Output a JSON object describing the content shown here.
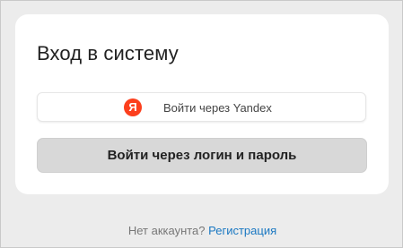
{
  "login": {
    "title": "Вход в систему",
    "yandex_button": {
      "logo_letter": "Я",
      "logo_color": "#fc3f1d",
      "label": "Войти через Yandex"
    },
    "password_button": {
      "label": "Войти через логин и пароль"
    }
  },
  "footer": {
    "no_account_text": "Нет аккаунта?",
    "register_link": "Регистрация"
  }
}
